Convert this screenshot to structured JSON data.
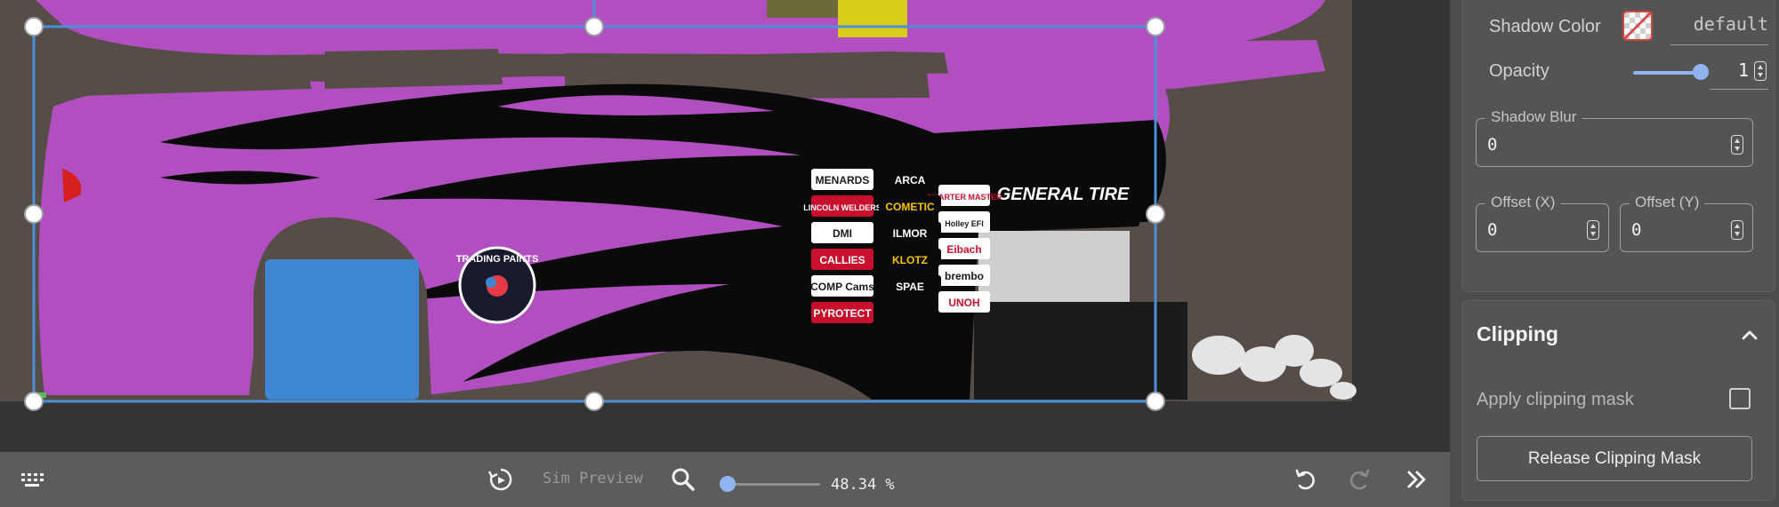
{
  "toolbar": {
    "sim_preview_label": "Sim Preview",
    "zoom_text": "48.34 %",
    "zoom_percent": 48.34,
    "zoom_slider_fraction": 0.05
  },
  "panel": {
    "shadow_color_label": "Shadow Color",
    "shadow_color_value": "default",
    "opacity_label": "Opacity",
    "opacity_value": "1",
    "opacity_fraction": 1,
    "shadow_blur_label": "Shadow Blur",
    "shadow_blur_value": "0",
    "offset_x_label": "Offset (X)",
    "offset_x_value": "0",
    "offset_y_label": "Offset (Y)",
    "offset_y_value": "0",
    "clipping_title": "Clipping",
    "apply_clipping_label": "Apply clipping mask",
    "apply_clipping_checked": false,
    "release_clipping_label": "Release Clipping Mask"
  },
  "canvas": {
    "sponsor_decals": [
      "MENARDS",
      "ARCA",
      "QUARTER MASTER",
      "LINCOLN WELDERS",
      "COMETIC",
      "Holley EFI",
      "DMI",
      "ILMOR",
      "Eibach",
      "CALLIES",
      "KLOTZ",
      "brembo",
      "COMP Cams",
      "SPAE",
      "UNOH",
      "PYROTECT"
    ],
    "tire_brand": "GENERAL TIRE",
    "round_badge": "TRADING PAINTS"
  },
  "colors": {
    "accent": "#8fb4f0",
    "selection": "#4a90d9",
    "livery_purple": "#b24fc0",
    "livery_black": "#0a0a0a",
    "template_grey": "#574d48",
    "decal_blue": "#3e86d0"
  }
}
